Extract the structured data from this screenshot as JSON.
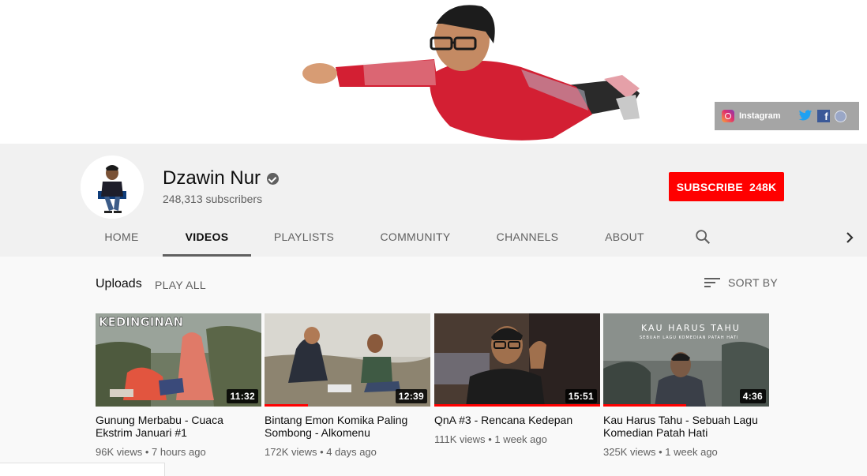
{
  "banner": {
    "social": {
      "instagram_label": "Instagram"
    }
  },
  "channel": {
    "name": "Dzawin Nur",
    "subscribers": "248,313 subscribers",
    "subscribe_label": "SUBSCRIBE",
    "subscribe_count": "248K"
  },
  "tabs": [
    {
      "label": "HOME"
    },
    {
      "label": "VIDEOS"
    },
    {
      "label": "PLAYLISTS"
    },
    {
      "label": "COMMUNITY"
    },
    {
      "label": "CHANNELS"
    },
    {
      "label": "ABOUT"
    }
  ],
  "uploads": {
    "title": "Uploads",
    "play_all": "PLAY ALL",
    "sort_label": "SORT BY"
  },
  "videos": [
    {
      "title": "Gunung Merbabu - Cuaca Ekstrim Januari #1",
      "views": "96K views",
      "age": "7 hours ago",
      "duration": "11:32",
      "thumb_text": "KEDINGINAN",
      "watched": 0
    },
    {
      "title": "Bintang Emon Komika Paling Sombong - Alkomenu",
      "views": "172K views",
      "age": "4 days ago",
      "duration": "12:39",
      "watched": 0.26
    },
    {
      "title": "QnA #3 - Rencana Kedepan",
      "views": "111K views",
      "age": "1 week ago",
      "duration": "15:51",
      "watched": 1.0
    },
    {
      "title": "Kau Harus Tahu - Sebuah Lagu Komedian Patah Hati",
      "views": "325K views",
      "age": "1 week ago",
      "duration": "4:36",
      "thumb_text": "KAU HARUS TAHU",
      "thumb_subtext": "SEBUAH LAGU KOMEDIAN PATAH HATI",
      "watched": 0.5
    }
  ]
}
